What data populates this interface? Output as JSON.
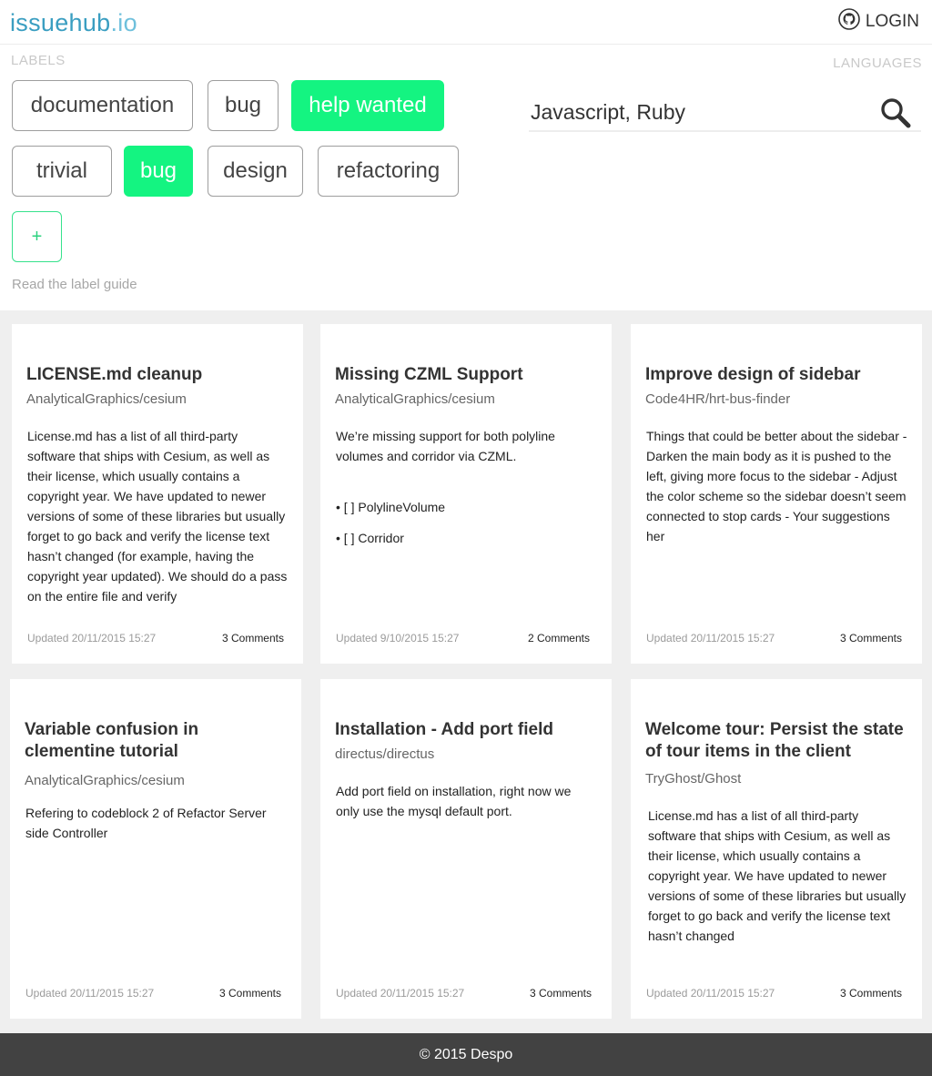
{
  "header": {
    "logo_main": "issuehub",
    "logo_suffix": ".io",
    "login_label": "LOGIN"
  },
  "filters": {
    "labels_caption": "LABELS",
    "languages_caption": "LANGUAGES",
    "tags": [
      {
        "label": "documentation",
        "active": false
      },
      {
        "label": "bug",
        "active": false
      },
      {
        "label": "help wanted",
        "active": true
      },
      {
        "label": "trivial",
        "active": false
      },
      {
        "label": "bug",
        "active": true
      },
      {
        "label": "design",
        "active": false
      },
      {
        "label": "refactoring",
        "active": false
      }
    ],
    "add_label": "+",
    "guide_link": "Read the label guide",
    "languages_value": "Javascript, Ruby"
  },
  "cards": [
    {
      "title": "LICENSE.md cleanup",
      "repo": "AnalyticalGraphics/cesium",
      "body": "License.md has a list of all third-party software that ships with Cesium, as well as their license, which usually contains a copyright year. We have updated to newer versions of some of these libraries but usually forget to go back and verify the license text hasn’t changed (for example, having the copyright year updated). We should do a pass on the entire file and verify",
      "updated": "Updated 20/11/2015 15:27",
      "comments": "3 Comments"
    },
    {
      "title": "Missing CZML Support",
      "repo": "AnalyticalGraphics/cesium",
      "body": "We’re missing support for both polyline volumes and corridor via CZML.",
      "list": [
        "[ ] PolylineVolume",
        "[ ] Corridor"
      ],
      "updated": "Updated 9/10/2015 15:27",
      "comments": "2 Comments"
    },
    {
      "title": "Improve design of sidebar",
      "repo": "Code4HR/hrt-bus-finder",
      "body": "Things that could be better about the sidebar - Darken the main body as it is pushed to the left, giving more focus to the sidebar - Adjust the color scheme so the sidebar doesn’t seem connected to stop cards - Your suggestions her",
      "updated": "Updated 20/11/2015 15:27",
      "comments": "3 Comments"
    },
    {
      "title": "Variable confusion in clementine tutorial",
      "repo": "AnalyticalGraphics/cesium",
      "body": "Refering to codeblock 2 of Refactor Server side Controller",
      "updated": "Updated 20/11/2015 15:27",
      "comments": "3 Comments"
    },
    {
      "title": "Installation - Add port field",
      "repo": "directus/directus",
      "body": "Add port field on installation, right now we only use the mysql default port.",
      "updated": "Updated 20/11/2015 15:27",
      "comments": "3 Comments"
    },
    {
      "title": "Welcome tour: Persist the state of tour items in the client",
      "repo": "TryGhost/Ghost",
      "body": "License.md has a list of all third-party software that ships with Cesium, as well as their license, which usually contains a copyright year. We have updated to newer versions of some of these libraries but usually forget to go back and verify the license text hasn’t changed",
      "updated": "Updated 20/11/2015 15:27",
      "comments": "3 Comments"
    }
  ],
  "footer": {
    "copyright": "© 2015 Despo"
  },
  "colors": {
    "accent_green": "#14f481",
    "logo_blue": "#3a9ec1",
    "footer_bg": "#424242"
  }
}
